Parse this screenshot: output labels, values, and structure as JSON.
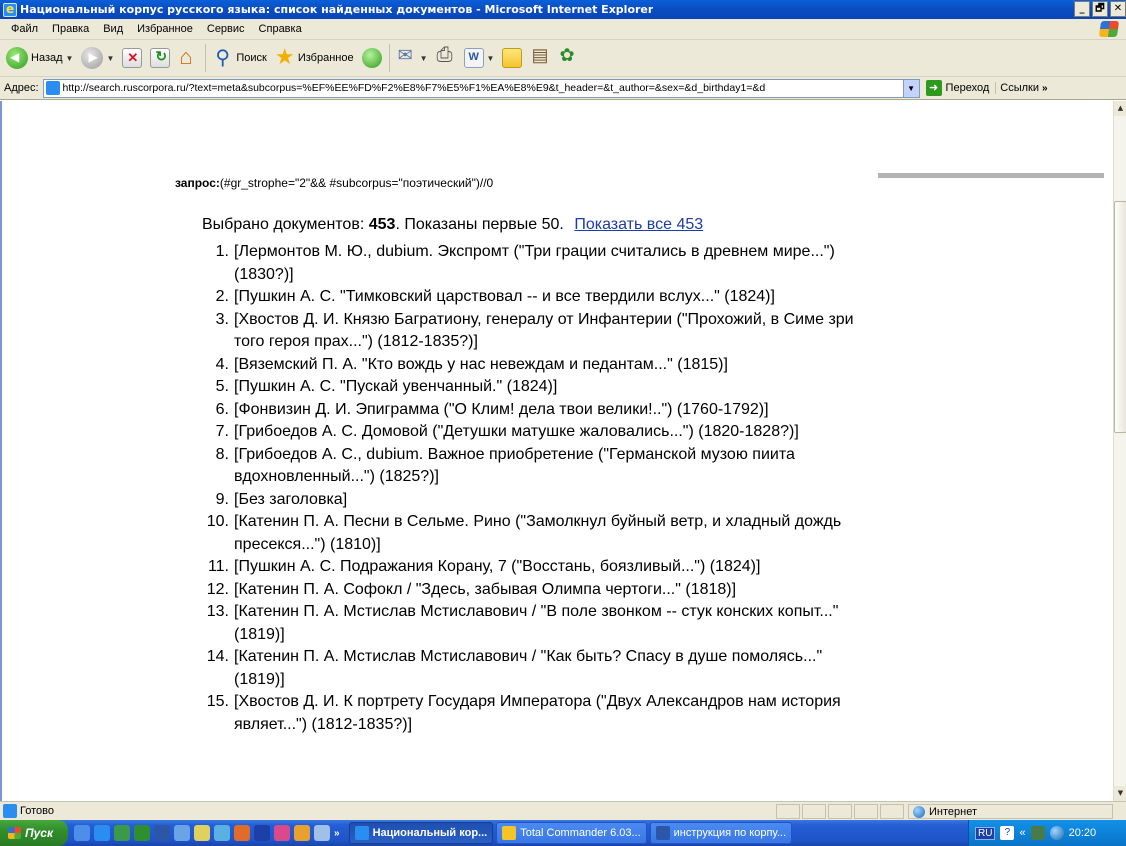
{
  "window": {
    "title": "Национальный корпус русского языка: список найденных документов - Microsoft Internet Explorer",
    "controls": [
      "_",
      "🗗",
      "✕"
    ]
  },
  "menu": [
    "Файл",
    "Правка",
    "Вид",
    "Избранное",
    "Сервис",
    "Справка"
  ],
  "toolbar": {
    "back_label": "Назад",
    "search_label": "Поиск",
    "favorites_label": "Избранное"
  },
  "address": {
    "label": "Адрес:",
    "url": "http://search.ruscorpora.ru/?text=meta&subcorpus=%EF%EE%FD%F2%E8%F7%E5%F1%EA%E8%E9&t_header=&t_author=&sex=&d_birthday1=&d",
    "go_label": "Переход",
    "links_label": "Ссылки"
  },
  "page": {
    "query_label": "запрос:",
    "query_text": "(#gr_strophe=\"2\"&& #subcorpus=\"поэтический\")//0",
    "selected_label": "Выбрано документов:",
    "selected_count": "453",
    "shown_text": ". Показаны первые 50.",
    "show_all_link": "Показать все 453",
    "documents": [
      {
        "n": "1.",
        "text": "[Лермонтов М. Ю., dubium. Экспромт (\"Три грации считались в древнем мире...\") (1830?)]"
      },
      {
        "n": "2.",
        "text": "[Пушкин А. С. \"Тимковский царствовал -- и все твердили вслух...\" (1824)]"
      },
      {
        "n": "3.",
        "text": "[Хвостов Д. И. Князю Багратиону, генералу от Инфантерии (\"Прохожий, в Симе зри того героя прах...\") (1812-1835?)]"
      },
      {
        "n": "4.",
        "text": "[Вяземский П. А. \"Кто вождь у нас невеждам и педантам...\" (1815)]"
      },
      {
        "n": "5.",
        "text": "[Пушкин А. С. \"Пускай увенчанный.\" (1824)]"
      },
      {
        "n": "6.",
        "text": "[Фонвизин Д. И. Эпиграмма (\"О Клим! дела твои велики!..\") (1760-1792)]"
      },
      {
        "n": "7.",
        "text": "[Грибоедов А. С. Домовой (\"Детушки матушке жаловались...\") (1820-1828?)]"
      },
      {
        "n": "8.",
        "text": "[Грибоедов А. С., dubium. Важное приобретение (\"Германской музою пиита вдохновленный...\") (1825?)]"
      },
      {
        "n": "9.",
        "text": "[Без заголовка]"
      },
      {
        "n": "10.",
        "text": "[Катенин П. А. Песни в Сельме. Рино (\"Замолкнул буйный ветр, и хладный дождь пресекся...\") (1810)]"
      },
      {
        "n": "11.",
        "text": "[Пушкин А. С. Подражания Корану, 7 (\"Восстань, боязливый...\") (1824)]"
      },
      {
        "n": "12.",
        "text": "[Катенин П. А. Софокл / \"Здесь, забывая Олимпа чертоги...\" (1818)]"
      },
      {
        "n": "13.",
        "text": "[Катенин П. А. Мстислав Мстиславович / \"В поле звонком -- стук конских копыт...\" (1819)]"
      },
      {
        "n": "14.",
        "text": "[Катенин П. А. Мстислав Мстиславович / \"Как быть? Спасу в душе помолясь...\" (1819)]"
      },
      {
        "n": "15.",
        "text": "[Хвостов Д. И. К портрету Государя Императора (\"Двух Александров нам история являет...\") (1812-1835?)]"
      }
    ]
  },
  "status": {
    "text": "Готово",
    "zone": "Интернет"
  },
  "taskbar": {
    "start_label": "Пуск",
    "more": "»",
    "tasks": [
      {
        "label": "Национальный кор...",
        "active": true
      },
      {
        "label": "Total Commander 6.03...",
        "active": false
      },
      {
        "label": "инструкция по корпу...",
        "active": false
      }
    ],
    "tray": {
      "lang": "RU",
      "help": "?",
      "chevron": "«",
      "time": "20:20"
    }
  },
  "colors": {
    "titlebar": "#0a5fd8",
    "link": "#1c3ca8",
    "taskbar": "#245ed5",
    "start": "#318e2b"
  }
}
